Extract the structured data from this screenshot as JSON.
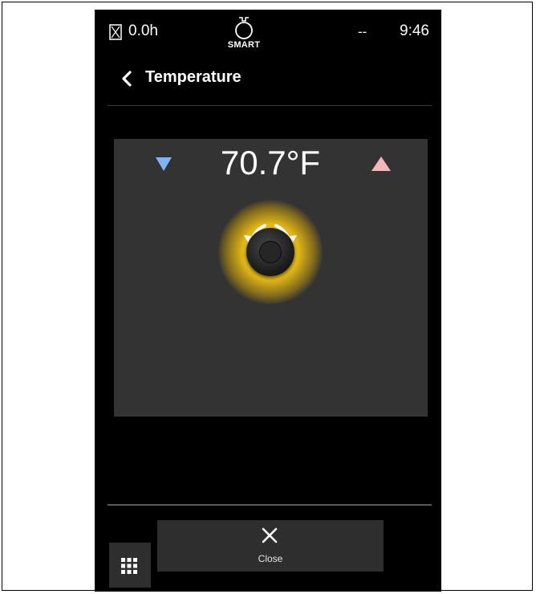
{
  "status_bar": {
    "hours": "0.0h",
    "smart_label": "SMART",
    "signal": "--",
    "time": "9:46"
  },
  "header": {
    "title": "Temperature"
  },
  "panel": {
    "temperature": "70.7°F",
    "down_arrow_color": "#7fb6ef",
    "up_arrow_color": "#f4b7b7",
    "knob_glow_color": "#f2c417"
  },
  "footer": {
    "close_label": "Close"
  },
  "icons": {
    "hourglass": "hourglass-icon",
    "smart": "smart-bulb-icon",
    "back": "chevron-left-icon",
    "down": "triangle-down-icon",
    "up": "triangle-up-icon",
    "rotate": "rotate-arrows-icon",
    "close": "close-icon",
    "grid": "grid-icon"
  }
}
